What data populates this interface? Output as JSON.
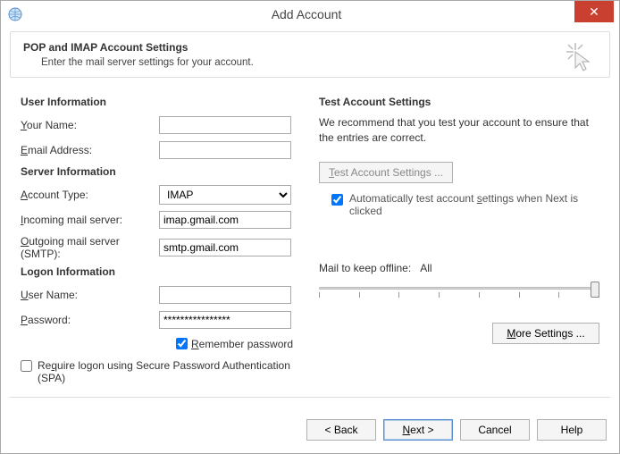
{
  "window": {
    "title": "Add Account"
  },
  "header": {
    "title": "POP and IMAP Account Settings",
    "subtitle": "Enter the mail server settings for your account."
  },
  "left": {
    "user_info_head": "User Information",
    "your_name_label": "Your Name:",
    "your_name_value": "",
    "email_label": "Email Address:",
    "email_value": "",
    "server_info_head": "Server Information",
    "account_type_label": "Account Type:",
    "account_type_value": "IMAP",
    "incoming_label": "Incoming mail server:",
    "incoming_value": "imap.gmail.com",
    "outgoing_label": "Outgoing mail server (SMTP):",
    "outgoing_value": "smtp.gmail.com",
    "logon_info_head": "Logon Information",
    "username_label": "User Name:",
    "username_value": "",
    "password_label": "Password:",
    "password_value": "****************",
    "remember_label": "Remember password",
    "spa_label": "Require logon using Secure Password Authentication (SPA)"
  },
  "right": {
    "test_head": "Test Account Settings",
    "test_desc": "We recommend that you test your account to ensure that the entries are correct.",
    "test_button": "Test Account Settings ...",
    "auto_test_label": "Automatically test account settings when Next is clicked",
    "offline_label": "Mail to keep offline:",
    "offline_value": "All",
    "more_settings": "More Settings ..."
  },
  "footer": {
    "back": "< Back",
    "next": "Next >",
    "cancel": "Cancel",
    "help": "Help"
  }
}
